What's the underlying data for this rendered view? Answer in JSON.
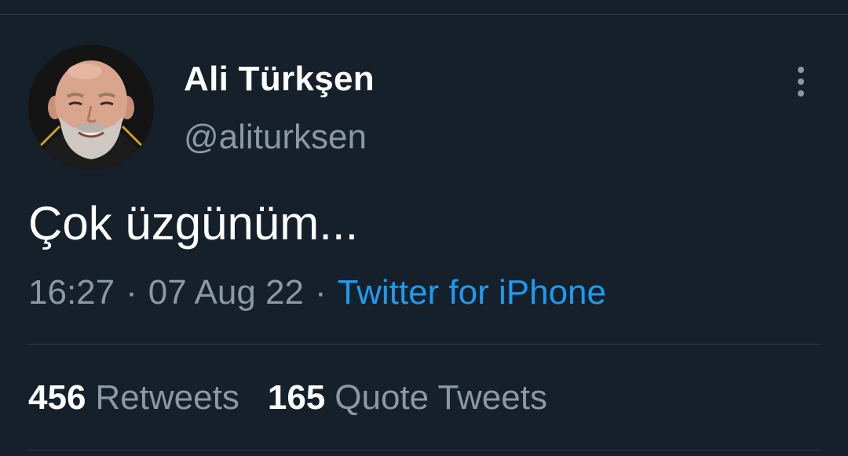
{
  "tweet": {
    "author": {
      "display_name": "Ali Türkşen",
      "handle": "@aliturksen",
      "avatar_icon": "user-avatar"
    },
    "text": "Çok üzgünüm...",
    "time": "16:27",
    "separator": "·",
    "date": "07 Aug 22",
    "source": "Twitter for iPhone",
    "more_icon": "more-vertical-icon"
  },
  "stats": {
    "retweets": {
      "count": "456",
      "label": "Retweets"
    },
    "quote_tweets": {
      "count": "165",
      "label": "Quote Tweets"
    }
  },
  "colors": {
    "background": "#15202b",
    "text_primary": "#ffffff",
    "text_secondary": "#8b98a5",
    "link": "#1d9bf0",
    "divider": "#2f3b47"
  }
}
